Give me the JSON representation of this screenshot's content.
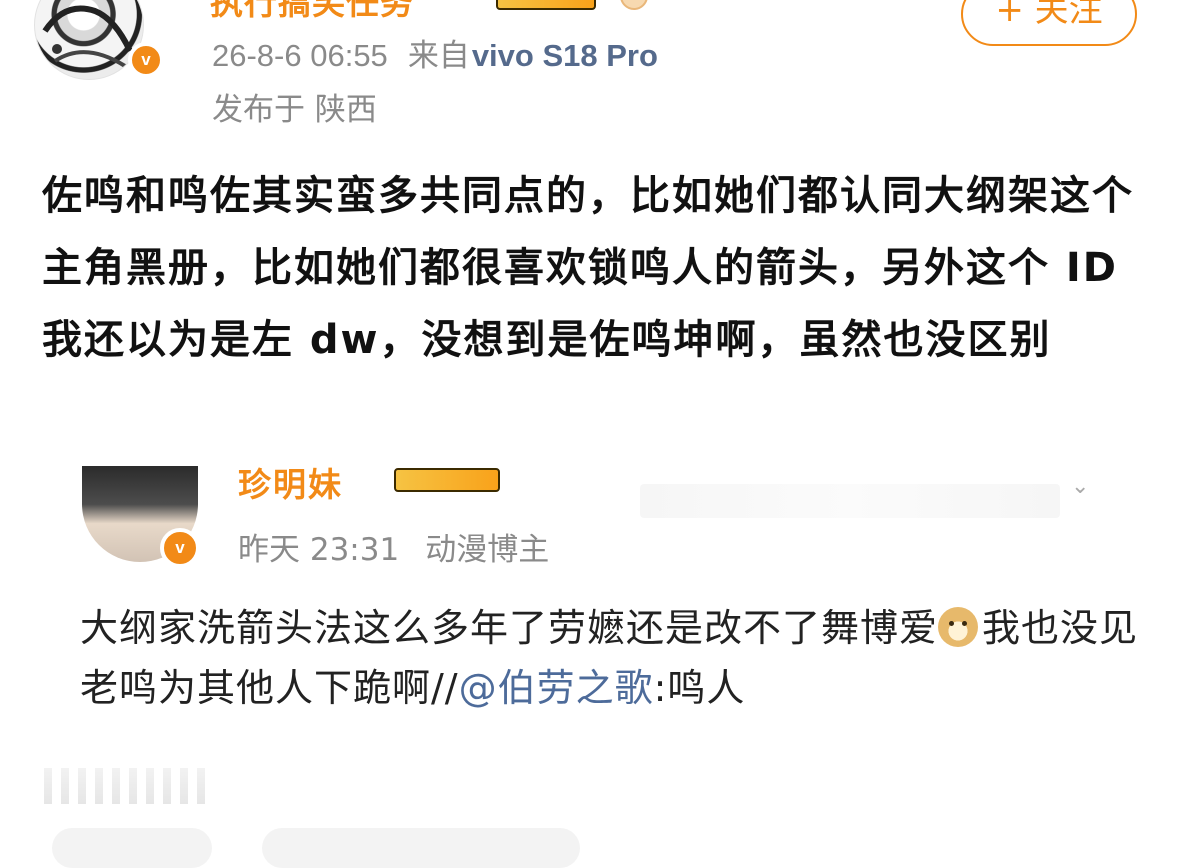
{
  "post": {
    "username": "执行搞笑任务",
    "follow_label": "+ 关注",
    "timestamp": "26-8-6 06:55",
    "source_prefix": "来自",
    "device": "vivo S18 Pro",
    "location": "发布于 陕西",
    "text": "佐鸣和鸣佐其实蛮多共同点的，比如她们都认同大纲架这个主角黑册，比如她们都很喜欢锁鸣人的箭头，另外这个 ID 我还以为是左 dw，没想到是佐鸣坤啊，虽然也没区别"
  },
  "repost": {
    "username": "珍明妹",
    "time": "昨天 23:31",
    "role": "动漫博主",
    "text_before_emoji": "大纲家洗箭头法这么多年了劳嬷还是改不了舞博爱",
    "emoji_name": "doge-emoji",
    "text_after_emoji": "我也没见老鸣为其他人下跪啊//",
    "mention": "@伯劳之歌",
    "text_after_mention": ":鸣人"
  },
  "badges": {
    "verified_symbol": "v",
    "verified_color": "#f28a17"
  },
  "colors": {
    "accent": "#f28a17",
    "meta_gray": "#8a8a8a",
    "link_blue": "#4d6b9a"
  }
}
